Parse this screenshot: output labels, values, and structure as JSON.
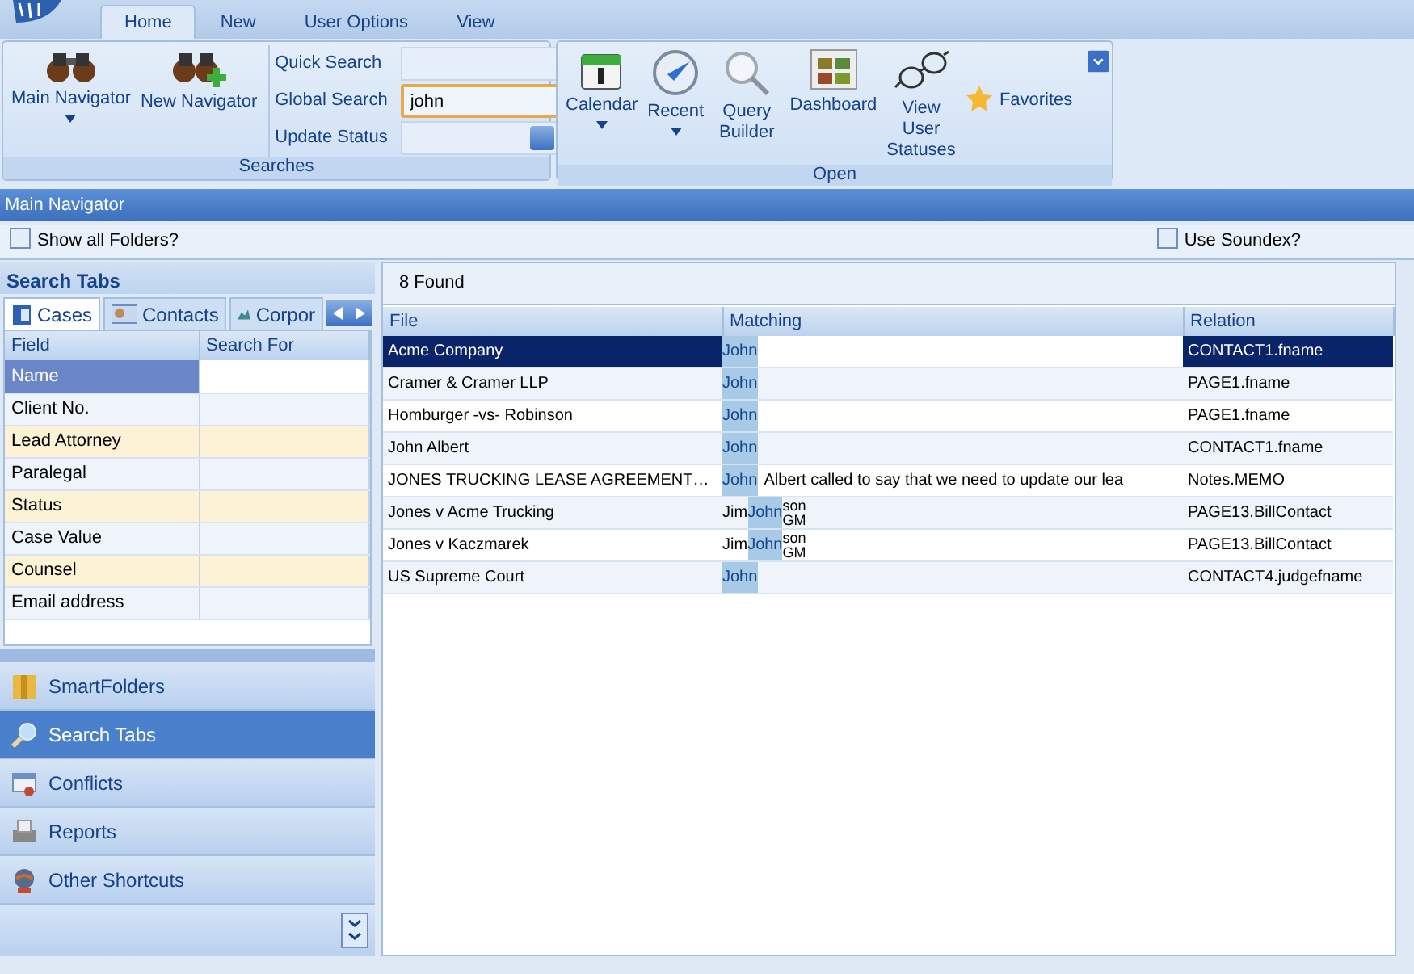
{
  "app_tabs": [
    {
      "label": "Home",
      "selected": true
    },
    {
      "label": "New",
      "selected": false
    },
    {
      "label": "User Options",
      "selected": false
    },
    {
      "label": "View",
      "selected": false
    }
  ],
  "ribbon": [
    {
      "title": "Searches",
      "buttons": [
        {
          "label": "Main Navigator",
          "kind": "binoculars",
          "dropdown": true
        },
        {
          "label": "New Navigator",
          "kind": "binoculars-plus",
          "dropdown": false
        }
      ],
      "fields": [
        {
          "label": "Quick Search",
          "kind": "text",
          "focused": false
        },
        {
          "label": "Global Search",
          "kind": "text",
          "value": "john",
          "focused": true
        },
        {
          "label": "Update Status",
          "kind": "dropdown"
        }
      ]
    },
    {
      "title": "Open",
      "buttons": [
        {
          "label": "Calendar",
          "kind": "calendar",
          "dropdown": true
        },
        {
          "label": "Recent",
          "kind": "clock",
          "dropdown": true
        },
        {
          "label": "Query Builder",
          "kind": "magnifier",
          "dropdown": false
        },
        {
          "label": "Dashboard",
          "kind": "dashboard",
          "dropdown": false
        },
        {
          "label": "View User Statuses",
          "kind": "glasses",
          "dropdown": false
        },
        {
          "label": "Favorites",
          "kind": "star",
          "dropdown": true
        }
      ]
    }
  ],
  "panel_title": "Main Navigator",
  "show_all_folders": {
    "label": "Show all Folders?",
    "checked": false
  },
  "use_soundex": {
    "label": "Use Soundex?",
    "checked": false
  },
  "search_tabs": {
    "title": "Search Tabs",
    "tabs": [
      {
        "label": "Cases",
        "kind": "cases",
        "selected": true
      },
      {
        "label": "Contacts",
        "kind": "contacts",
        "selected": false
      },
      {
        "label": "Corpor",
        "kind": "corporate",
        "selected": false
      }
    ],
    "columns": [
      "Field",
      "Search For"
    ],
    "rows": [
      {
        "field": "Name",
        "selected": true,
        "highlighted": false
      },
      {
        "field": "Client No.",
        "selected": false,
        "highlighted": false
      },
      {
        "field": "Lead Attorney",
        "selected": false,
        "highlighted": true
      },
      {
        "field": "Paralegal",
        "selected": false,
        "highlighted": false
      },
      {
        "field": "Status",
        "selected": false,
        "highlighted": true
      },
      {
        "field": "Case Value",
        "selected": false,
        "highlighted": false
      },
      {
        "field": "Counsel",
        "selected": false,
        "highlighted": true
      },
      {
        "field": "Email address",
        "selected": false,
        "highlighted": false
      }
    ]
  },
  "nav_items": [
    {
      "label": "SmartFolders",
      "kind": "folder",
      "selected": false
    },
    {
      "label": "Search Tabs",
      "kind": "search",
      "selected": true
    },
    {
      "label": "Conflicts",
      "kind": "conflicts",
      "selected": false
    },
    {
      "label": "Reports",
      "kind": "printer",
      "selected": false
    },
    {
      "label": "Other Shortcuts",
      "kind": "globe",
      "selected": false
    }
  ],
  "results": {
    "count": "8 Found",
    "columns": [
      "File",
      "Matching",
      "Relation"
    ],
    "rows": [
      {
        "file": "Acme Company",
        "matching": [
          {
            "text": "John",
            "matched": true
          }
        ],
        "relation": "CONTACT1.fname",
        "selected": true
      },
      {
        "file": "Cramer & Cramer LLP",
        "matching": [
          {
            "text": "John",
            "matched": true
          }
        ],
        "relation": "PAGE1.fname",
        "selected": false
      },
      {
        "file": "Homburger -vs- Robinson",
        "matching": [
          {
            "text": "John",
            "matched": true
          }
        ],
        "relation": "PAGE1.fname",
        "selected": false
      },
      {
        "file": "John Albert",
        "matching": [
          {
            "text": "John",
            "matched": true
          }
        ],
        "relation": "CONTACT1.fname",
        "selected": false
      },
      {
        "file": "JONES TRUCKING LEASE AGREEMENT…",
        "matching": [
          {
            "text": "John",
            "matched": true
          },
          {
            "text": "Albert called to say that we need to update our lea",
            "matched": false
          }
        ],
        "relation": "Notes.MEMO",
        "selected": false
      },
      {
        "file": "Jones v Acme Trucking",
        "matching": [
          {
            "text": "Jim",
            "matched": false
          },
          {
            "text": "John",
            "matched": true
          },
          {
            "lines": [
              "son",
              "GM"
            ],
            "matched": false
          }
        ],
        "relation": "PAGE13.BillContact",
        "selected": false
      },
      {
        "file": "Jones v Kaczmarek",
        "matching": [
          {
            "text": "Jim",
            "matched": false
          },
          {
            "text": "John",
            "matched": true
          },
          {
            "lines": [
              "son",
              "GM"
            ],
            "matched": false
          }
        ],
        "relation": "PAGE13.BillContact",
        "selected": false
      },
      {
        "file": "US Supreme Court",
        "matching": [
          {
            "text": "John",
            "matched": true
          }
        ],
        "relation": "CONTACT4.judgefname",
        "selected": false
      }
    ]
  }
}
